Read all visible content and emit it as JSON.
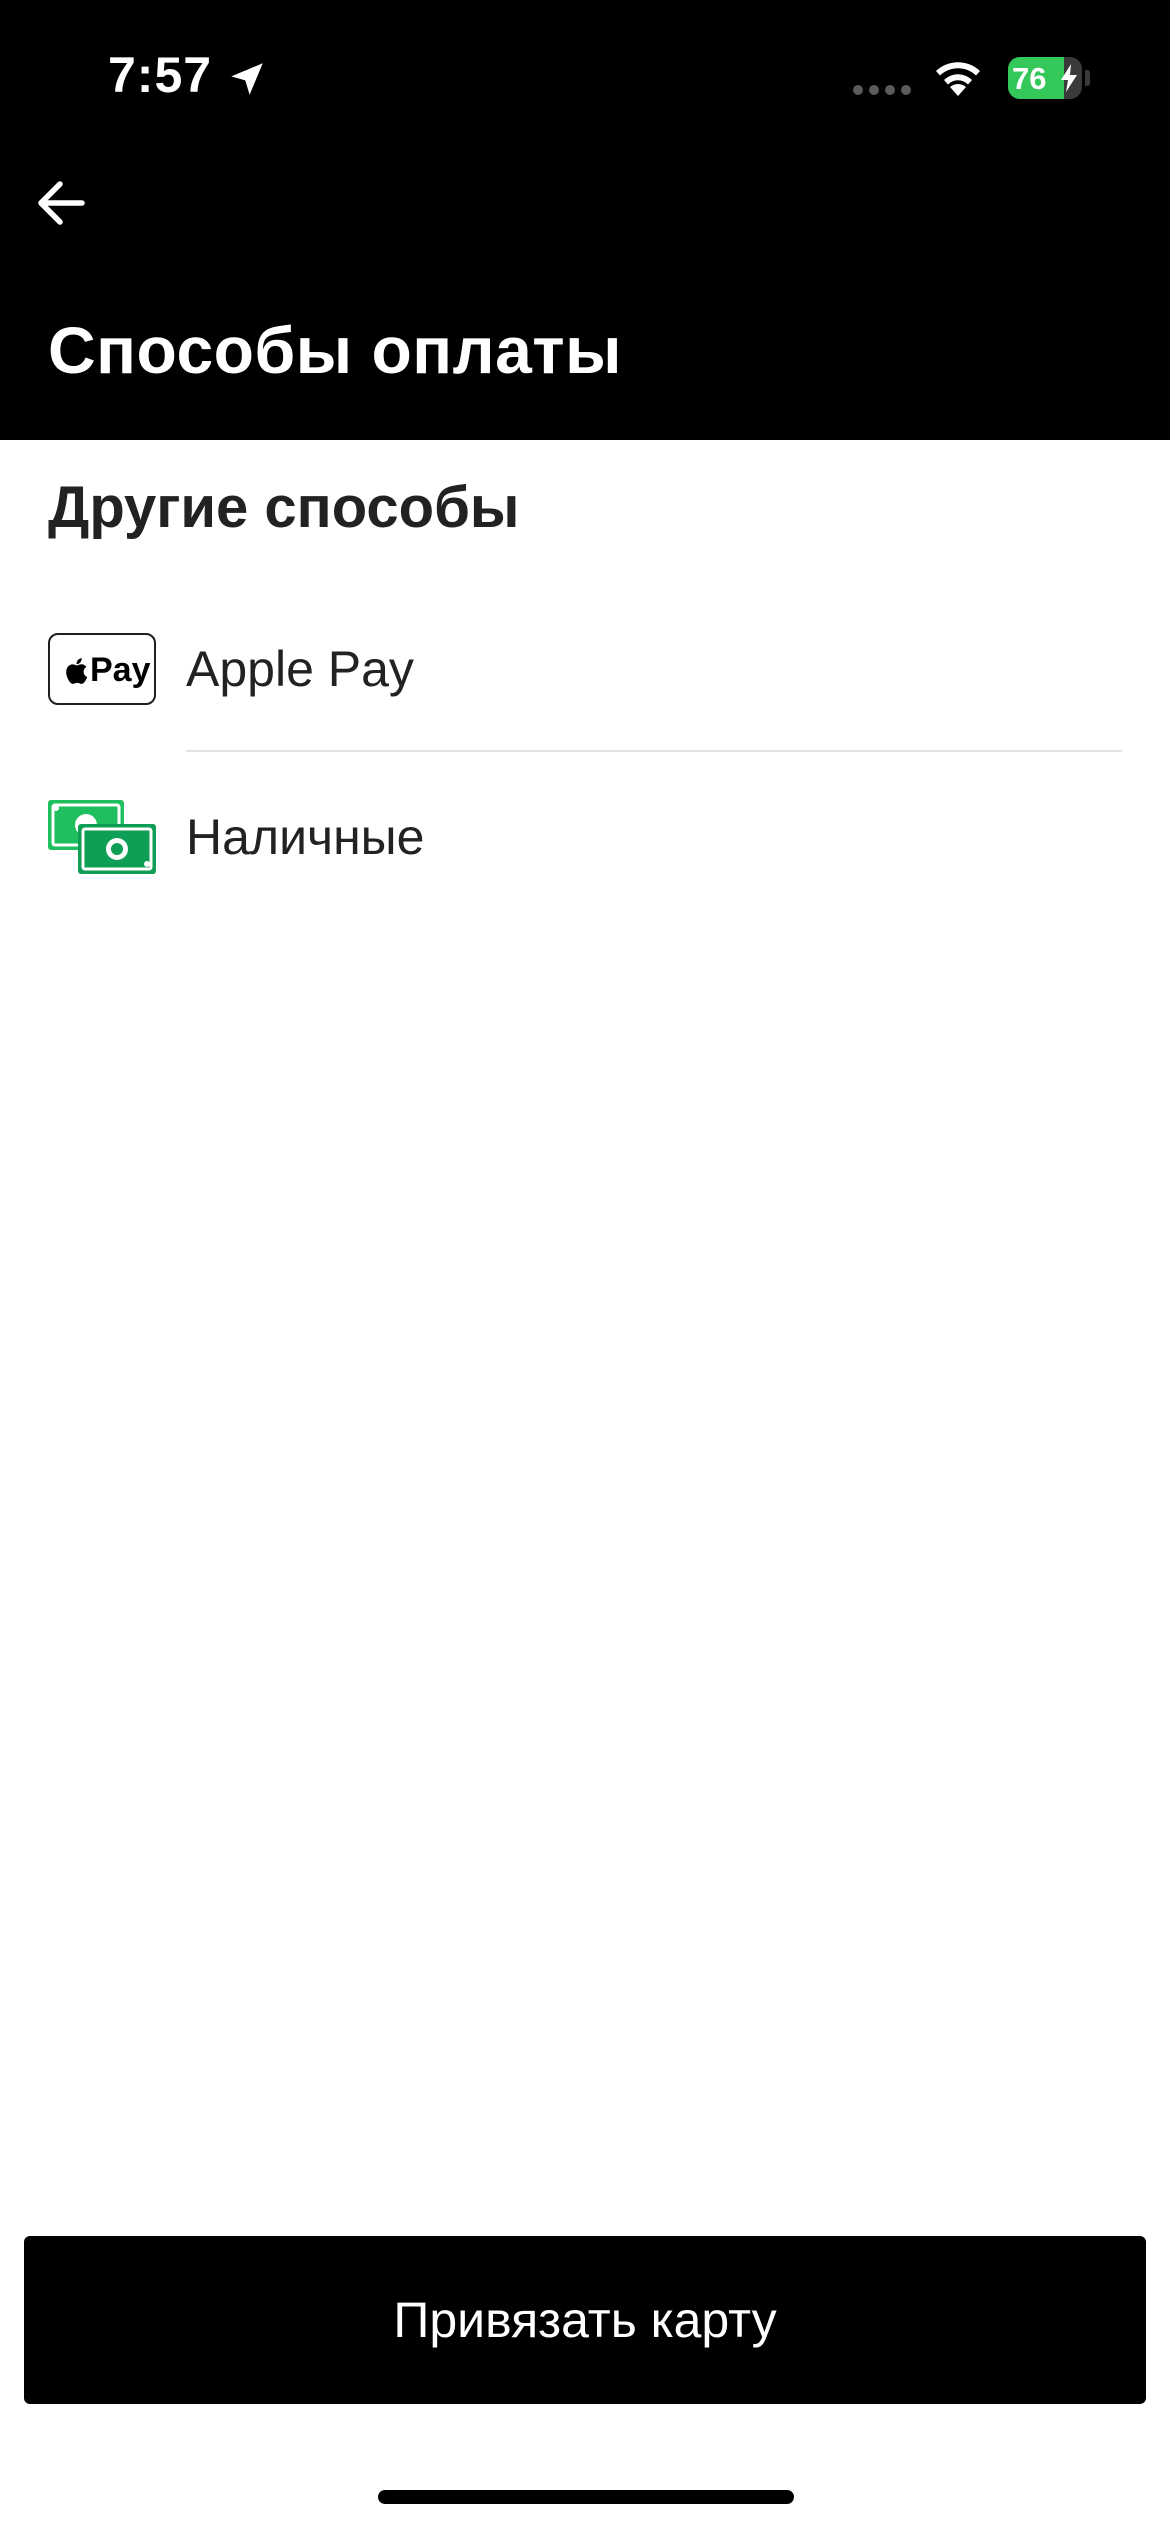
{
  "status_bar": {
    "time": "7:57",
    "battery_level": "76",
    "battery_fraction": 0.76
  },
  "header": {
    "title": "Способы оплаты"
  },
  "section": {
    "title": "Другие способы"
  },
  "payment_methods": [
    {
      "label": "Apple Pay",
      "logo_text": "Pay",
      "icon": "apple-pay-icon"
    },
    {
      "label": "Наличные",
      "icon": "cash-icon"
    }
  ],
  "actions": {
    "bind_card_label": "Привязать карту"
  },
  "colors": {
    "header_bg": "#000000",
    "button_bg": "#000000",
    "cash_green": "#1fbf5f",
    "battery_green": "#34c759"
  }
}
